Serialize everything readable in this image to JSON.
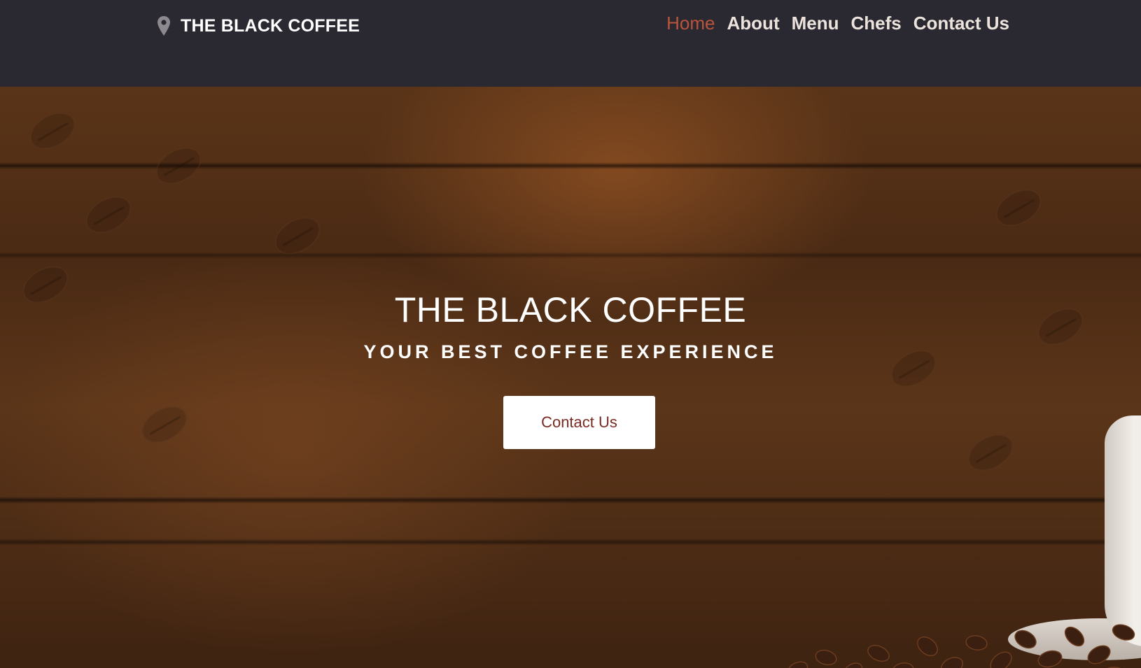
{
  "header": {
    "brand_name": "THE BLACK COFFEE",
    "brand_icon": "map-pin-icon",
    "nav": [
      {
        "label": "Home",
        "active": true
      },
      {
        "label": "About",
        "active": false
      },
      {
        "label": "Menu",
        "active": false
      },
      {
        "label": "Chefs",
        "active": false
      },
      {
        "label": "Contact Us",
        "active": false
      }
    ]
  },
  "hero": {
    "title": "THE BLACK COFFEE",
    "subtitle": "YOUR BEST COFFEE EXPERIENCE",
    "cta_label": "Contact Us"
  },
  "colors": {
    "header_bg": "#2a2830",
    "nav_active": "#b9553d",
    "nav_text": "#ebe3dc",
    "cta_text": "#7a2a22",
    "cta_bg": "#ffffff"
  }
}
